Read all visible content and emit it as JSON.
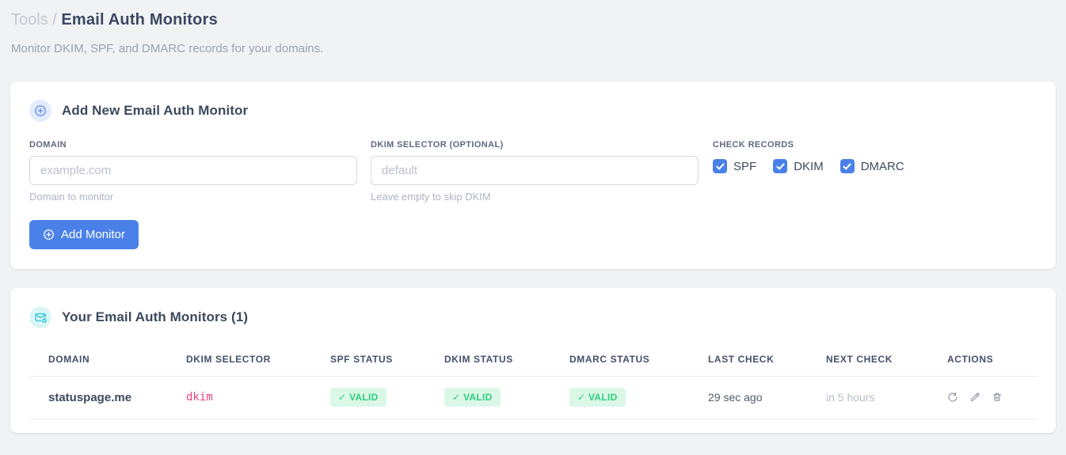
{
  "page": {
    "breadcrumb_parent": "Tools",
    "breadcrumb_separator": "/",
    "title": "Email Auth Monitors",
    "subtitle": "Monitor DKIM, SPF, and DMARC records for your domains."
  },
  "add_form": {
    "title": "Add New Email Auth Monitor",
    "domain_field": {
      "label": "DOMAIN",
      "placeholder": "example.com",
      "value": "",
      "hint": "Domain to monitor"
    },
    "dkim_field": {
      "label": "DKIM SELECTOR (OPTIONAL)",
      "placeholder": "default",
      "value": "",
      "hint": "Leave empty to skip DKIM"
    },
    "check_records": {
      "label": "CHECK RECORDS",
      "options": [
        {
          "label": "SPF",
          "checked": true
        },
        {
          "label": "DKIM",
          "checked": true
        },
        {
          "label": "DMARC",
          "checked": true
        }
      ]
    },
    "submit_label": "Add Monitor"
  },
  "monitors": {
    "title": "Your Email Auth Monitors (1)",
    "table": {
      "headers": [
        "DOMAIN",
        "DKIM SELECTOR",
        "SPF STATUS",
        "DKIM STATUS",
        "DMARC STATUS",
        "LAST CHECK",
        "NEXT CHECK",
        "ACTIONS"
      ],
      "rows": [
        {
          "domain": "statuspage.me",
          "dkim_selector": "dkim",
          "spf_status": "✓ VALID",
          "dkim_status": "✓ VALID",
          "dmarc_status": "✓ VALID",
          "last_check": "29 sec ago",
          "next_check": "in 5 hours"
        }
      ]
    }
  },
  "colors": {
    "accent_blue": "#4a81e8",
    "icon_blue": "#5b8def",
    "icon_teal": "#2bc9d6",
    "badge_green_bg": "#dbf8e7",
    "badge_green_text": "#2dce7d",
    "selector_pink": "#e8467c"
  }
}
